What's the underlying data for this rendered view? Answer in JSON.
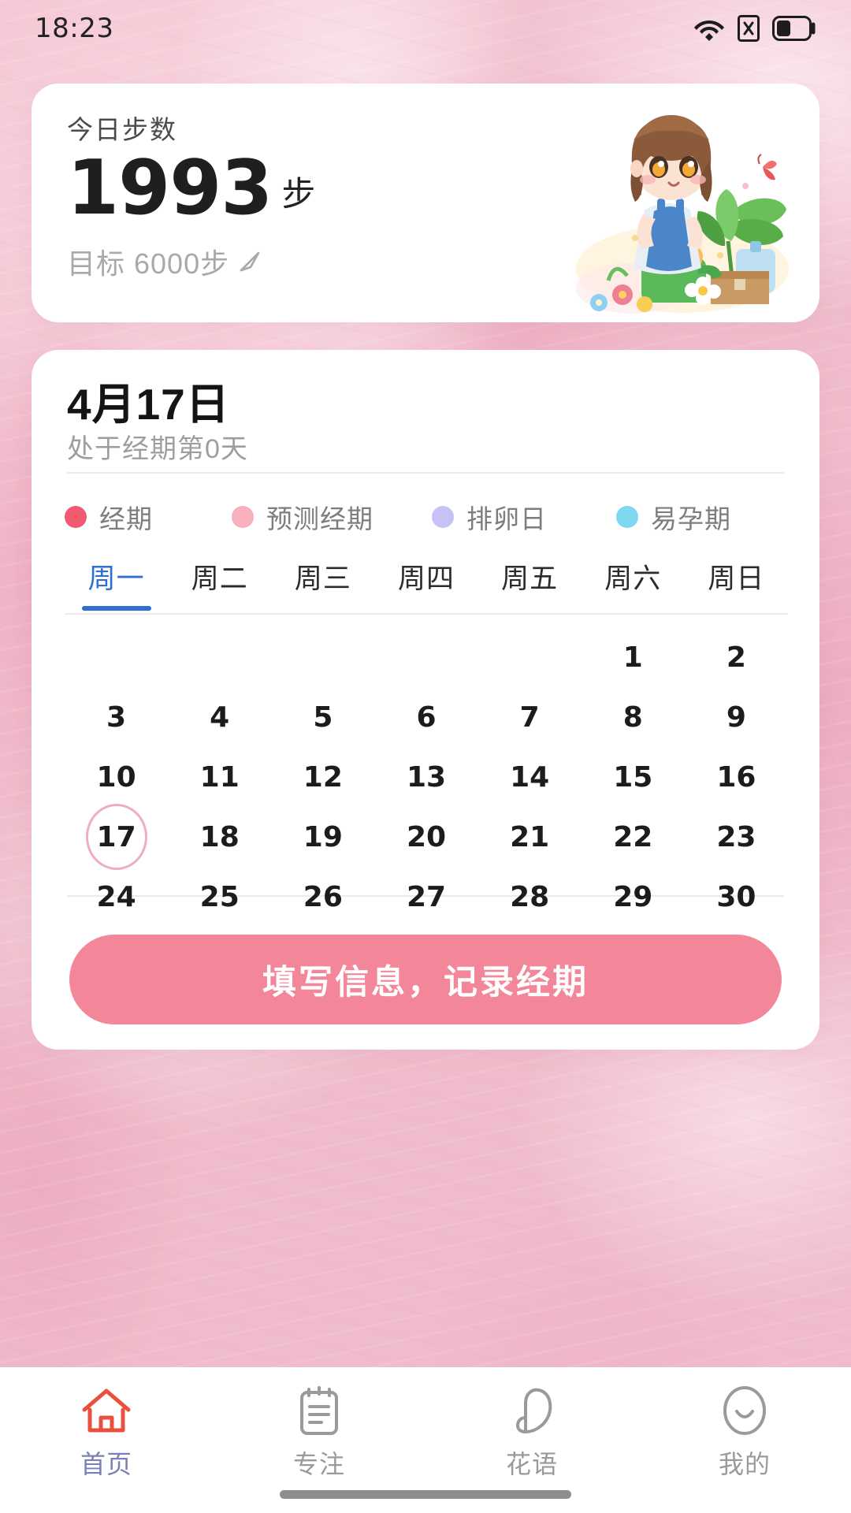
{
  "status_bar": {
    "time": "18:23",
    "icons": [
      "wifi-icon",
      "no-signal-icon",
      "battery-icon"
    ]
  },
  "steps_card": {
    "title": "今日步数",
    "count": "1993",
    "unit": "步",
    "goal_text": "目标 6000步",
    "edit_icon": "pencil-edit-icon",
    "illustration": "girl-gardening-illustration"
  },
  "period_card": {
    "date": "4月17日",
    "subtitle": "处于经期第0天",
    "legend": [
      {
        "label": "经期",
        "color": "#f05b72"
      },
      {
        "label": "预测经期",
        "color": "#f9afbe"
      },
      {
        "label": "排卵日",
        "color": "#c6c2f3"
      },
      {
        "label": "易孕期",
        "color": "#7ed8f2"
      }
    ],
    "weekdays": [
      {
        "label": "周一",
        "active": true
      },
      {
        "label": "周二",
        "active": false
      },
      {
        "label": "周三",
        "active": false
      },
      {
        "label": "周四",
        "active": false
      },
      {
        "label": "周五",
        "active": false
      },
      {
        "label": "周六",
        "active": false
      },
      {
        "label": "周日",
        "active": false
      }
    ],
    "days": [
      "",
      "",
      "",
      "",
      "",
      "1",
      "2",
      "3",
      "4",
      "5",
      "6",
      "7",
      "8",
      "9",
      "10",
      "11",
      "12",
      "13",
      "14",
      "15",
      "16",
      "17",
      "18",
      "19",
      "20",
      "21",
      "22",
      "23",
      "24",
      "25",
      "26",
      "27",
      "28",
      "29",
      "30"
    ],
    "today": "17",
    "cta_label": "填写信息，记录经期",
    "cta_color": "#f38698",
    "today_ring_color": "#eeaec1",
    "active_weekday_color": "#2f6fd0"
  },
  "tabbar": {
    "items": [
      {
        "label": "首页",
        "icon": "home-icon",
        "active": true
      },
      {
        "label": "专注",
        "icon": "clipboard-icon",
        "active": false
      },
      {
        "label": "花语",
        "icon": "petal-icon",
        "active": false
      },
      {
        "label": "我的",
        "icon": "smiley-face-icon",
        "active": false
      }
    ],
    "active_icon_color": "#e8503f",
    "active_label_color": "#7a7fb6",
    "inactive_color": "#9a9a9a"
  }
}
